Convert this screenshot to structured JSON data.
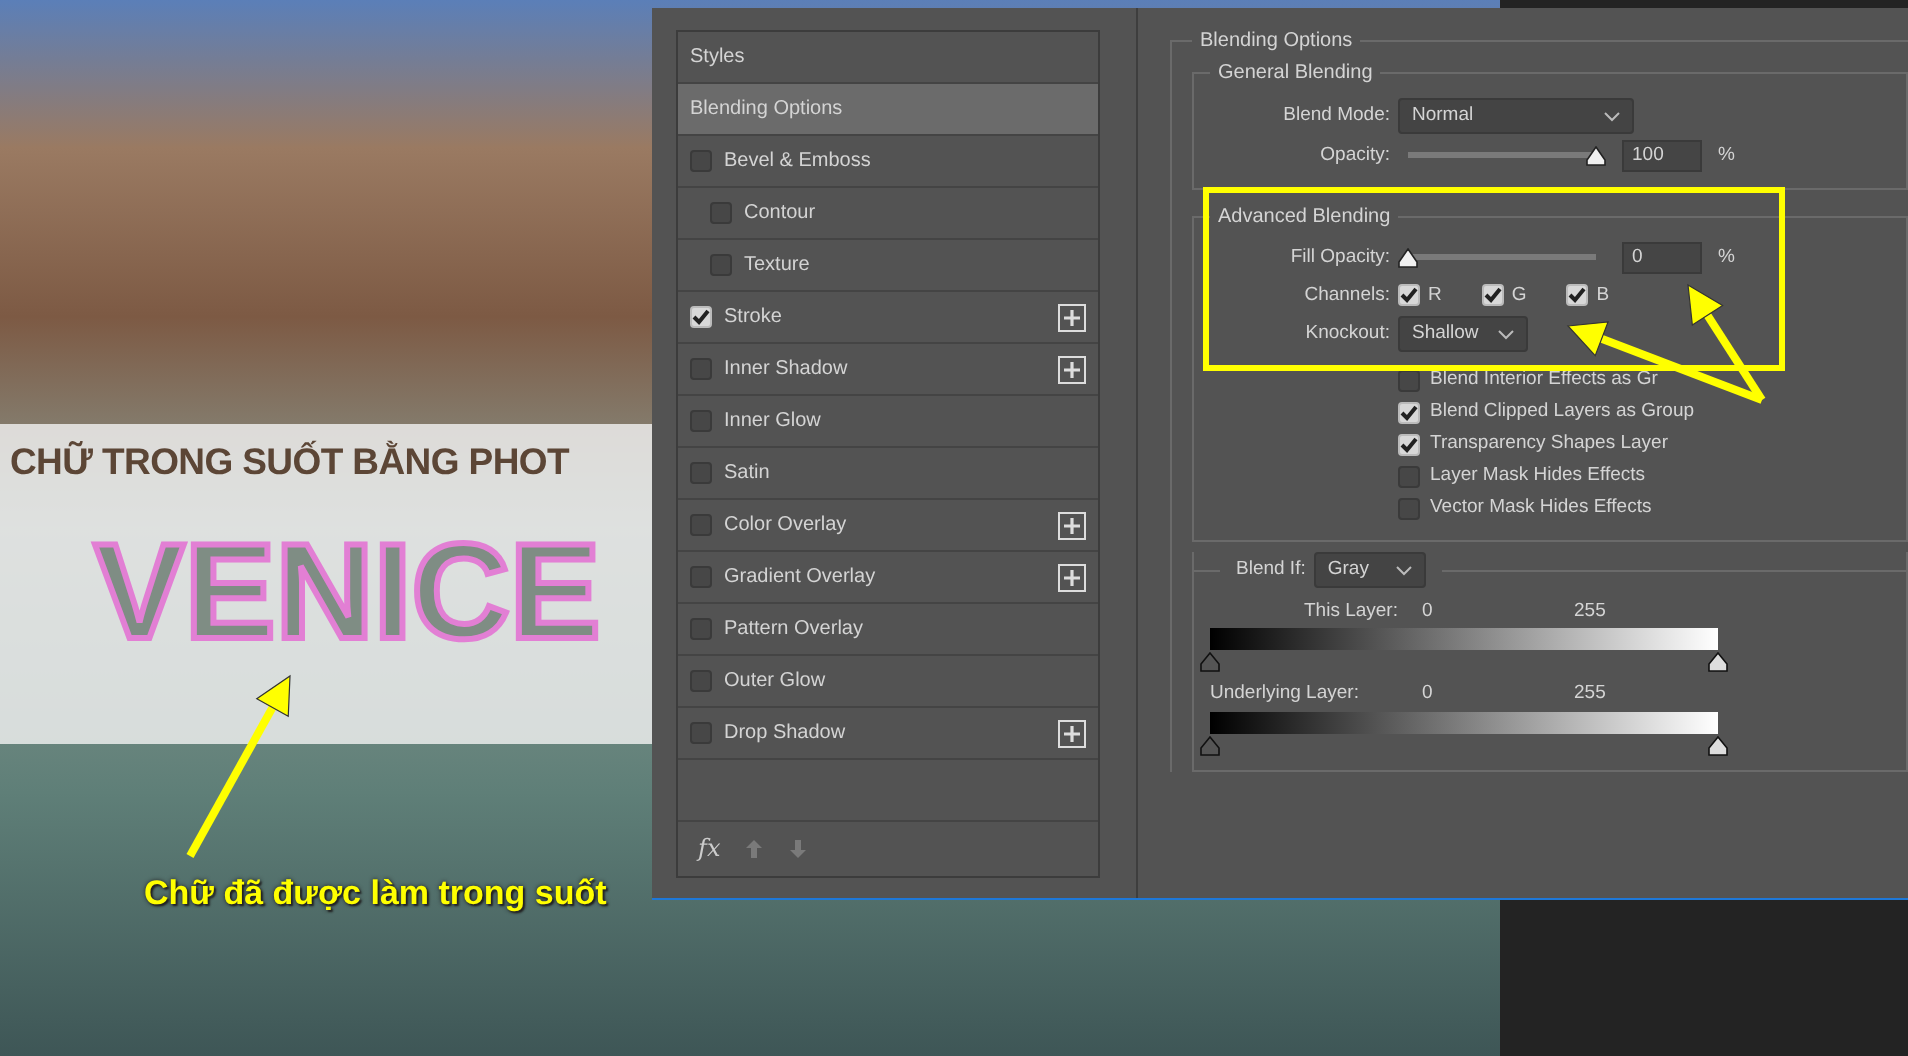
{
  "canvas": {
    "banner_title": "CHỮ TRONG SUỐT BẰNG PHOT",
    "headline": "VENICE",
    "annotation": "Chữ đã được làm trong suốt"
  },
  "styles_panel": {
    "items": [
      {
        "label": "Styles",
        "kind": "plain",
        "selected": false
      },
      {
        "label": "Blending Options",
        "kind": "plain",
        "selected": true
      },
      {
        "label": "Bevel & Emboss",
        "kind": "check",
        "checked": false,
        "addable": false,
        "selected": false
      },
      {
        "label": "Contour",
        "kind": "subcheck",
        "checked": false,
        "addable": false,
        "selected": false
      },
      {
        "label": "Texture",
        "kind": "subcheck",
        "checked": false,
        "addable": false,
        "selected": false
      },
      {
        "label": "Stroke",
        "kind": "check",
        "checked": true,
        "addable": true,
        "selected": false
      },
      {
        "label": "Inner Shadow",
        "kind": "check",
        "checked": false,
        "addable": true,
        "selected": false
      },
      {
        "label": "Inner Glow",
        "kind": "check",
        "checked": false,
        "addable": false,
        "selected": false
      },
      {
        "label": "Satin",
        "kind": "check",
        "checked": false,
        "addable": false,
        "selected": false
      },
      {
        "label": "Color Overlay",
        "kind": "check",
        "checked": false,
        "addable": true,
        "selected": false
      },
      {
        "label": "Gradient Overlay",
        "kind": "check",
        "checked": false,
        "addable": true,
        "selected": false
      },
      {
        "label": "Pattern Overlay",
        "kind": "check",
        "checked": false,
        "addable": false,
        "selected": false
      },
      {
        "label": "Outer Glow",
        "kind": "check",
        "checked": false,
        "addable": false,
        "selected": false
      },
      {
        "label": "Drop Shadow",
        "kind": "check",
        "checked": false,
        "addable": true,
        "selected": false
      }
    ],
    "footer_fx": "fx"
  },
  "blending_options": {
    "title": "Blending Options",
    "general": {
      "title": "General Blending",
      "blend_mode_label": "Blend Mode:",
      "blend_mode": "Normal",
      "opacity_label": "Opacity:",
      "opacity": {
        "level": 1,
        "value": "100",
        "unit": "%"
      }
    },
    "advanced": {
      "title": "Advanced Blending",
      "fill_opacity_label": "Fill Opacity:",
      "fill_opacity": {
        "level": 0,
        "value": "0",
        "unit": "%"
      },
      "channels_label": "Channels:",
      "channels": [
        {
          "label": "R",
          "checked": true
        },
        {
          "label": "G",
          "checked": true
        },
        {
          "label": "B",
          "checked": true
        }
      ],
      "knockout_label": "Knockout:",
      "knockout": "Shallow",
      "options": [
        {
          "label": "Blend Interior Effects as Gr",
          "checked": false
        },
        {
          "label": "Blend Clipped Layers as Group",
          "checked": true
        },
        {
          "label": "Transparency Shapes Layer",
          "checked": true
        },
        {
          "label": "Layer Mask Hides Effects",
          "checked": false
        },
        {
          "label": "Vector Mask Hides Effects",
          "checked": false
        }
      ]
    },
    "blend_if": {
      "label": "Blend If:",
      "value": "Gray",
      "ranges": [
        {
          "label": "This Layer:",
          "low": "0",
          "high": "255"
        },
        {
          "label": "Underlying Layer:",
          "low": "0",
          "high": "255"
        }
      ]
    }
  }
}
